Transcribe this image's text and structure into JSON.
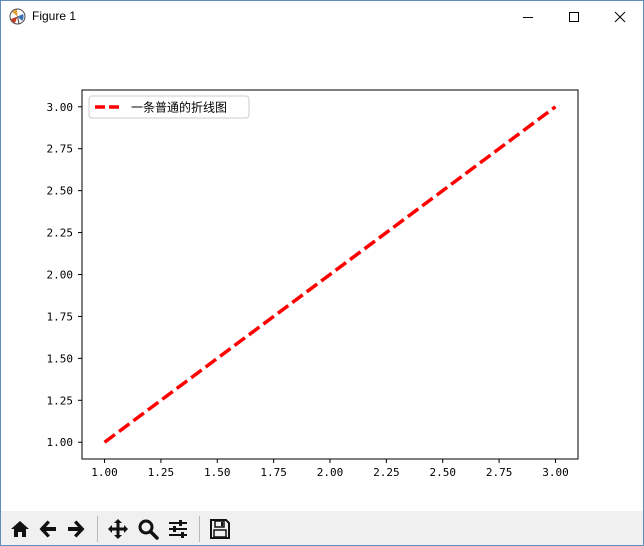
{
  "window": {
    "title": "Figure 1",
    "icons": {
      "app": "matplotlib-icon",
      "minimize": "minimize-icon",
      "maximize": "maximize-icon",
      "close": "close-icon"
    }
  },
  "toolbar": {
    "buttons": [
      {
        "name": "home-button",
        "icon": "home-icon"
      },
      {
        "name": "back-button",
        "icon": "arrow-left-icon"
      },
      {
        "name": "forward-button",
        "icon": "arrow-right-icon"
      },
      {
        "name": "pan-button",
        "icon": "move-icon"
      },
      {
        "name": "zoom-button",
        "icon": "magnifier-icon"
      },
      {
        "name": "configure-subplots-button",
        "icon": "sliders-icon"
      },
      {
        "name": "save-button",
        "icon": "floppy-disk-icon"
      }
    ]
  },
  "chart_data": {
    "type": "line",
    "title": "",
    "xlabel": "",
    "ylabel": "",
    "x": [
      1.0,
      2.0,
      3.0
    ],
    "series": [
      {
        "name": "一条普通的折线图",
        "values": [
          1.0,
          2.0,
          3.0
        ],
        "color": "#ff0000",
        "linestyle": "dashed"
      }
    ],
    "xlim": [
      0.9,
      3.1
    ],
    "ylim": [
      0.9,
      3.1
    ],
    "xticks": [
      "1.00",
      "1.25",
      "1.50",
      "1.75",
      "2.00",
      "2.25",
      "2.50",
      "2.75",
      "3.00"
    ],
    "yticks": [
      "1.00",
      "1.25",
      "1.50",
      "1.75",
      "2.00",
      "2.25",
      "2.50",
      "2.75",
      "3.00"
    ],
    "grid": false,
    "legend_position": "upper-left"
  }
}
